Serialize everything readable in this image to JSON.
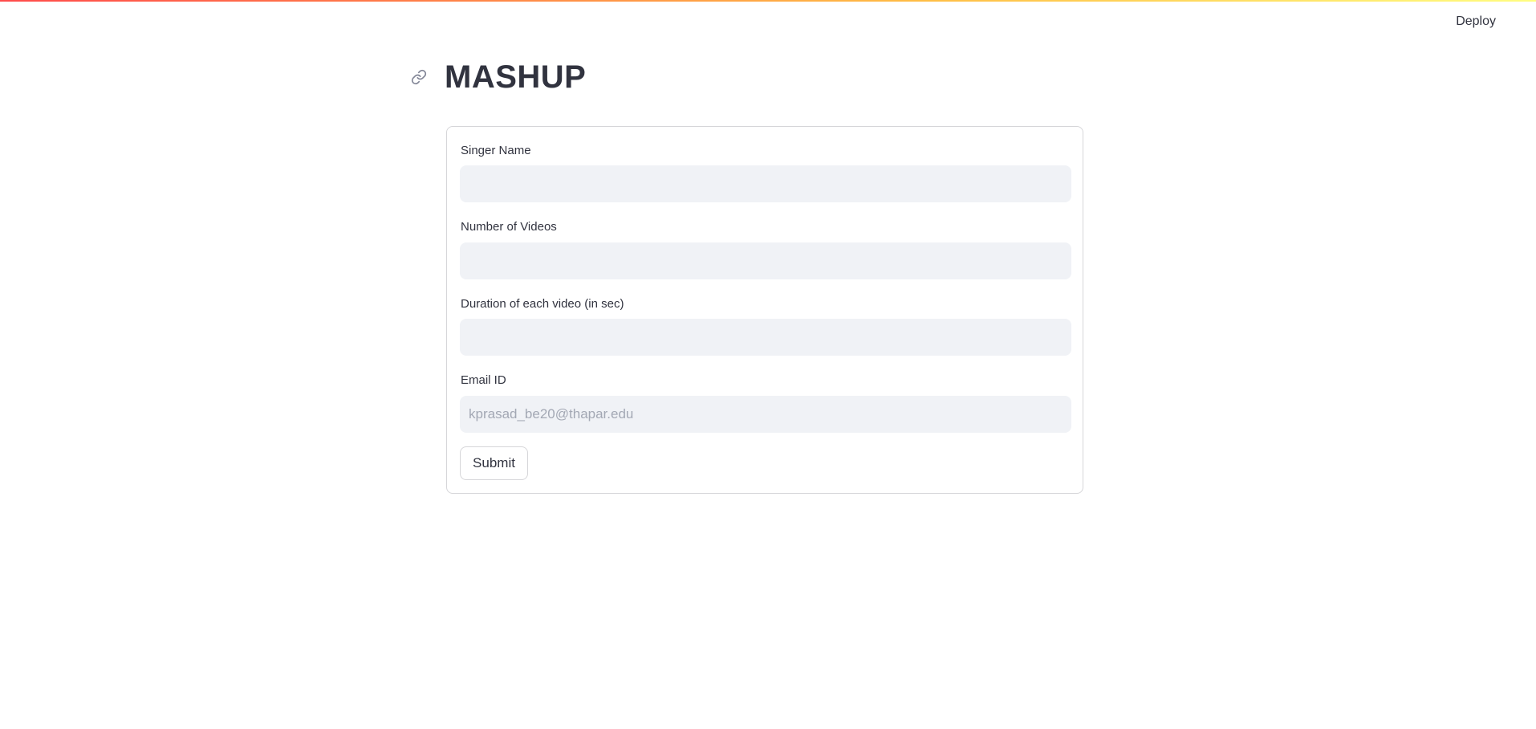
{
  "header": {
    "deploy_label": "Deploy"
  },
  "page": {
    "title": "MASHUP",
    "anchor_icon": "link-icon"
  },
  "form": {
    "fields": [
      {
        "label": "Singer Name",
        "value": "",
        "placeholder": ""
      },
      {
        "label": "Number of Videos",
        "value": "",
        "placeholder": ""
      },
      {
        "label": "Duration of each video (in sec)",
        "value": "",
        "placeholder": ""
      },
      {
        "label": "Email ID",
        "value": "",
        "placeholder": "kprasad_be20@thapar.edu"
      }
    ],
    "submit_label": "Submit"
  },
  "colors": {
    "accent_start": "#ff4b4b",
    "accent_end": "#fffd80",
    "input_bg": "#f0f2f6",
    "text": "#31333f"
  }
}
